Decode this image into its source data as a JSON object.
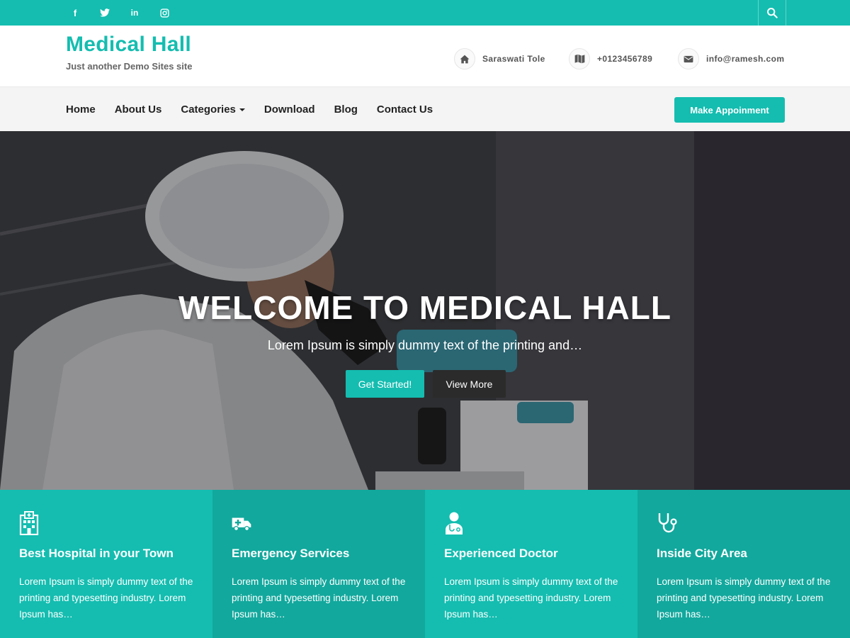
{
  "topbar": {
    "social": [
      {
        "icon": "facebook-icon",
        "glyph": "f"
      },
      {
        "icon": "twitter-icon",
        "glyph": "t"
      },
      {
        "icon": "linkedin-icon",
        "glyph": "in"
      },
      {
        "icon": "instagram-icon",
        "glyph": ""
      }
    ],
    "search_icon": "search-icon"
  },
  "header": {
    "title": "Medical Hall",
    "tagline": "Just another Demo Sites site",
    "contacts": [
      {
        "icon": "home-icon",
        "text": "Saraswati Tole"
      },
      {
        "icon": "map-icon",
        "text": "+0123456789"
      },
      {
        "icon": "envelope-icon",
        "text": "info@ramesh.com"
      }
    ]
  },
  "nav": {
    "items": [
      {
        "label": "Home"
      },
      {
        "label": "About Us"
      },
      {
        "label": "Categories",
        "has_dropdown": true
      },
      {
        "label": "Download"
      },
      {
        "label": "Blog"
      },
      {
        "label": "Contact Us"
      }
    ],
    "cta_label": "Make Appoinment"
  },
  "hero": {
    "title": "WELCOME TO MEDICAL HALL",
    "subtitle": "Lorem Ipsum is simply dummy text of the printing and…",
    "primary_button": "Get Started!",
    "secondary_button": "View More"
  },
  "features": [
    {
      "icon": "hospital-icon",
      "title": "Best Hospital in your Town",
      "text": "Lorem Ipsum is simply dummy text of the printing and typesetting industry. Lorem Ipsum has…"
    },
    {
      "icon": "ambulance-icon",
      "title": "Emergency Services",
      "text": "Lorem Ipsum is simply dummy text of the printing and typesetting industry. Lorem Ipsum has…"
    },
    {
      "icon": "doctor-icon",
      "title": "Experienced Doctor",
      "text": "Lorem Ipsum is simply dummy text of the printing and typesetting industry. Lorem Ipsum has…"
    },
    {
      "icon": "stethoscope-icon",
      "title": "Inside City Area",
      "text": "Lorem Ipsum is simply dummy text of the printing and typesetting industry. Lorem Ipsum has…"
    }
  ],
  "colors": {
    "accent": "#14bdb0",
    "accent_dark": "#12a89d",
    "dark_button": "#2b2b2b"
  }
}
